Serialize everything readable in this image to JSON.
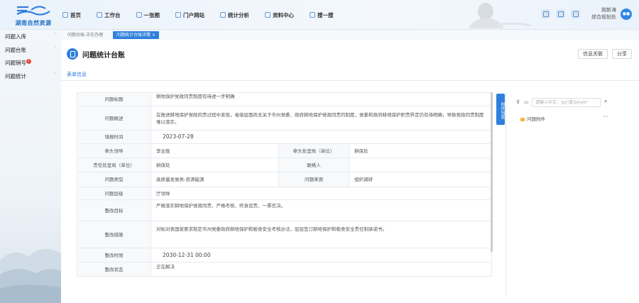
{
  "brand": {
    "logo_text": "湖南自然资源"
  },
  "nav": [
    {
      "label": "首页",
      "icon": "home-icon",
      "bold": true
    },
    {
      "label": "工作台",
      "icon": "desktop-icon",
      "bold": true
    },
    {
      "label": "一张图",
      "icon": "map-icon",
      "bold": true
    },
    {
      "label": "门户网站",
      "icon": "portal-icon",
      "bold": true
    },
    {
      "label": "统计分析",
      "icon": "chart-icon",
      "bold": true
    },
    {
      "label": "资料中心",
      "icon": "database-icon",
      "bold": true
    },
    {
      "label": "搜一搜",
      "icon": "search-icon",
      "bold": true
    }
  ],
  "user": {
    "name": "姚新涛",
    "dept": "综合规划处",
    "avatar_text": "●●"
  },
  "sidebar": {
    "items": [
      {
        "label": "问题入库"
      },
      {
        "label": "问题台账"
      },
      {
        "label": "问题销号",
        "badge": "!"
      },
      {
        "label": "问题统计"
      }
    ]
  },
  "tabs": [
    {
      "label": "问题台账-正在办理"
    },
    {
      "label": "问题统计台账详情 ×"
    }
  ],
  "page": {
    "title": "问题统计台账",
    "buttons": {
      "info_link": "信息关联",
      "share": "分享"
    },
    "subtab": "表单信息"
  },
  "form": {
    "title_label": "问题标题",
    "title_value": "耕地保护党政同责制度有待进一步明确",
    "desc_label": "问题概述",
    "desc_value": "在推进耕地保护党政同责过程中发现，省级层面尚无关于市州党委、政府耕地保护党政同责的制度，党委和政府耕地保护职责界定仍有待明确，导致党政同责制度难以落实。",
    "date_label": "填报时间",
    "date_value": "2023-07-28",
    "leader_label": "牵头领导",
    "leader_value": "李全胜",
    "lead_dept_label": "牵头处室局（单位）",
    "lead_dept_value": "耕保处",
    "resp_dept_label": "责任处室局（单位）",
    "resp_dept_value": "耕保处",
    "contact_label": "联络人",
    "contact_value": "",
    "type_label": "问题类型",
    "type_value": "高质量发展类-资源能源",
    "source_label": "问题来源",
    "source_value": "组织调研",
    "level_label": "问题层级",
    "level_value": "厅领导",
    "goal_label": "整改目标",
    "goal_value": "严格落实耕地保护党政同责、严格考核、终身追责、一票否决。",
    "measure_label": "整改措施",
    "measure_value": "对标对表国家要求制定市州党委政府耕地保护和粮食安全考核办法，层层签订耕地保护和粮食安全责任制承诺书。",
    "deadline_label": "整改时限",
    "deadline_value": "2030-12-31 00:00",
    "status_label": "整改状态",
    "status_value": "正在解决"
  },
  "attachments": {
    "tab_label": "附件列表",
    "search_placeholder": "请输入中文、'py'或'pinyin'",
    "node_label": "问题附件",
    "more": "···"
  }
}
